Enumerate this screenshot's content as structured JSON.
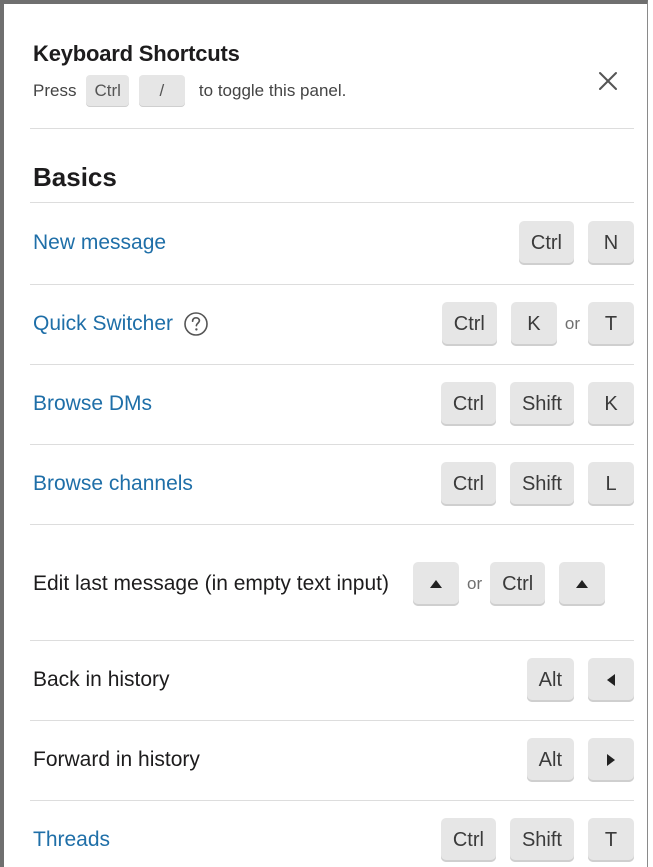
{
  "header": {
    "title": "Keyboard Shortcuts",
    "subtitle_prefix": "Press",
    "subtitle_key1": "Ctrl",
    "subtitle_key2": "/",
    "subtitle_suffix": "to toggle this panel."
  },
  "section": {
    "title": "Basics"
  },
  "separator": "or",
  "shortcuts": [
    {
      "label": "New message",
      "link": true,
      "keys": [
        "Ctrl",
        "N"
      ]
    },
    {
      "label": "Quick Switcher",
      "link": true,
      "help_icon": "question-circle-icon",
      "keys": [
        "Ctrl",
        "K",
        "or",
        "T"
      ]
    },
    {
      "label": "Browse DMs",
      "link": true,
      "keys": [
        "Ctrl",
        "Shift",
        "K"
      ]
    },
    {
      "label": "Browse channels",
      "link": true,
      "keys": [
        "Ctrl",
        "Shift",
        "L"
      ]
    },
    {
      "label": "Edit last message (in empty text input)",
      "link": false,
      "keys": [
        "arrow-up-icon",
        "or",
        "Ctrl",
        "arrow-up-icon"
      ]
    },
    {
      "label": "Back in history",
      "link": false,
      "keys": [
        "Alt",
        "arrow-left-icon"
      ]
    },
    {
      "label": "Forward in history",
      "link": false,
      "keys": [
        "Alt",
        "arrow-right-icon"
      ]
    },
    {
      "label": "Threads",
      "link": true,
      "keys": [
        "Ctrl",
        "Shift",
        "T"
      ]
    }
  ],
  "colors": {
    "link": "#1f6fa8",
    "key_background": "#e6e6e6",
    "divider": "#dddddd"
  },
  "icons": {
    "close": "close-icon",
    "help": "question-circle-icon"
  }
}
